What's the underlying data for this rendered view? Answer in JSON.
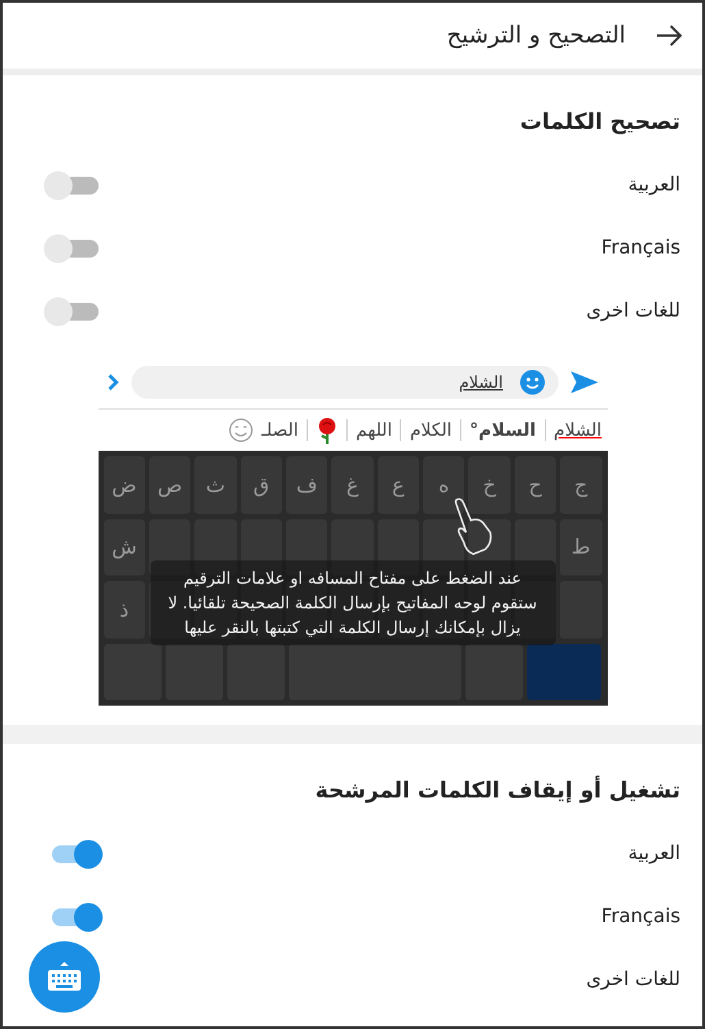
{
  "header": {
    "title": "التصحيح و الترشيح"
  },
  "sections": [
    {
      "title": "تصحيح الكلمات",
      "rows": [
        {
          "label": "العربية",
          "on": false
        },
        {
          "label": "Français",
          "on": false
        },
        {
          "label": "للغات اخرى",
          "on": false
        }
      ]
    },
    {
      "title": "تشغيل أو إيقاف الكلمات المرشحة",
      "rows": [
        {
          "label": "العربية",
          "on": true
        },
        {
          "label": "Français",
          "on": true
        },
        {
          "label": "للغات اخرى"
        }
      ]
    }
  ],
  "preview": {
    "input_value": "الشلام",
    "suggestions": [
      {
        "kind": "word",
        "text": "الشلام",
        "underlined": true
      },
      {
        "kind": "word",
        "text": "السلام°",
        "bold": true
      },
      {
        "kind": "word",
        "text": "الكلام"
      },
      {
        "kind": "word",
        "text": "اللهم"
      },
      {
        "kind": "rose"
      },
      {
        "kind": "word",
        "text": "الصلـ"
      },
      {
        "kind": "smiley"
      }
    ],
    "top_keys": [
      "ج",
      "ح",
      "خ",
      "ه",
      "ع",
      "غ",
      "ف",
      "ق",
      "ث",
      "ص",
      "ض"
    ],
    "middle_row_ends": [
      "ط",
      "ش"
    ],
    "third_row_end": "ذ",
    "hint": "عند الضغط على مفتاح المسافه او علامات الترقيم ستقوم لوحه المفاتيح بإرسال الكلمة الصحيحة تلقائيا. لا يزال بإمكانك إرسال الكلمة التي كتبتها بالنقر عليها"
  }
}
